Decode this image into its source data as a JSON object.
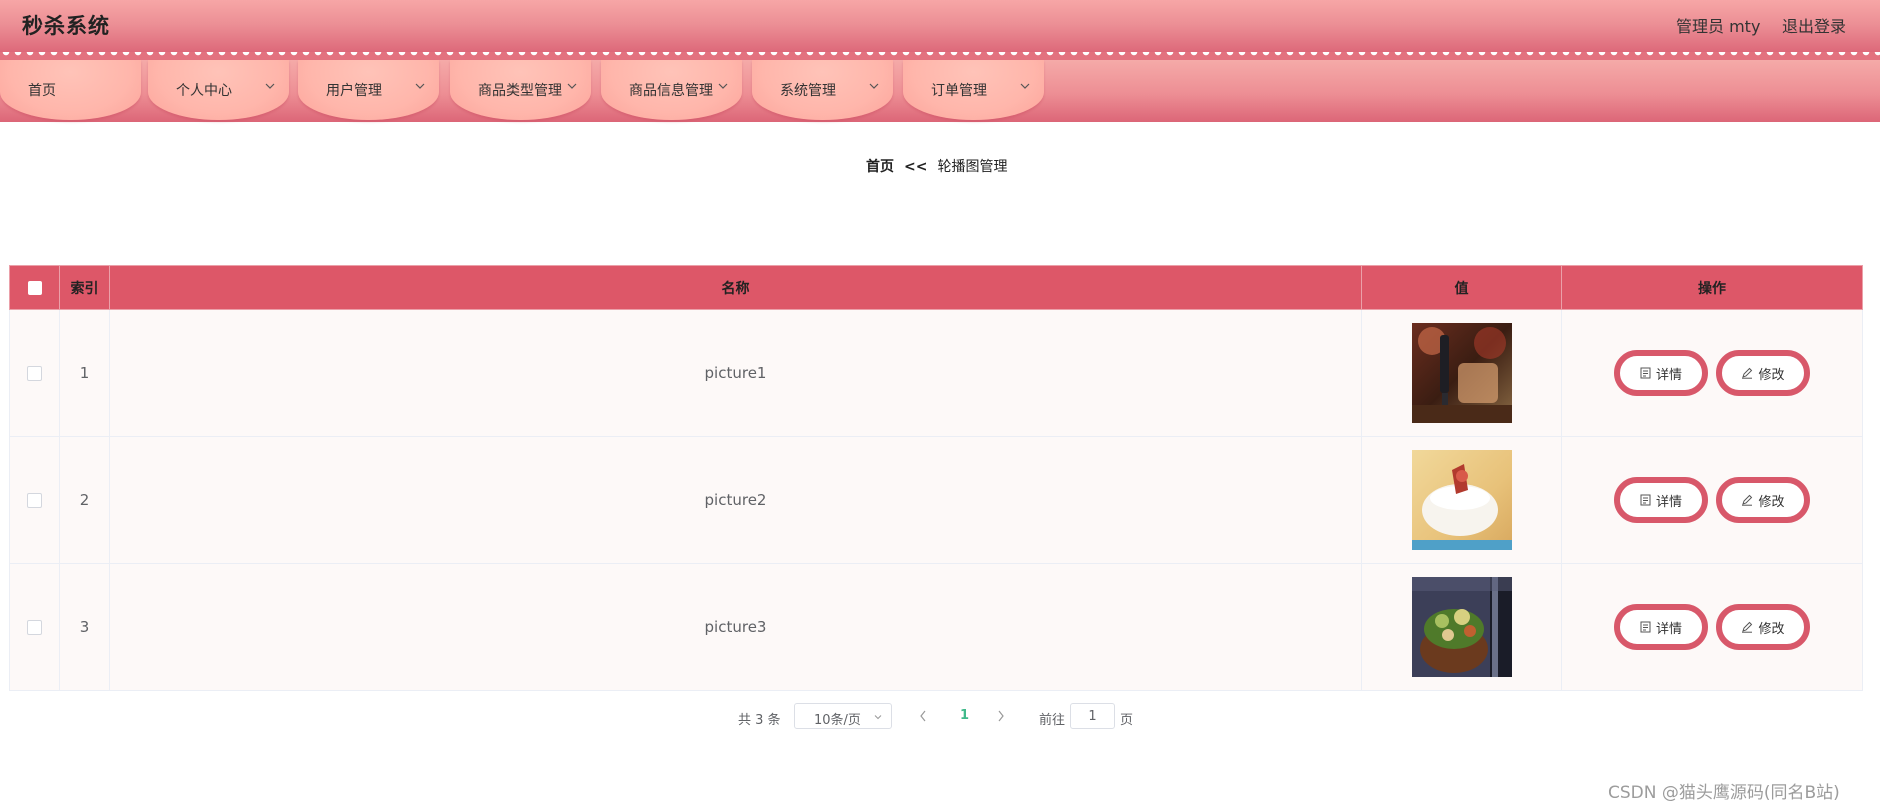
{
  "header": {
    "app_title": "秒杀系统",
    "user_label": "管理员 mty",
    "logout_label": "退出登录"
  },
  "nav": {
    "items": [
      {
        "label": "首页",
        "has_dropdown": false
      },
      {
        "label": "个人中心",
        "has_dropdown": true
      },
      {
        "label": "用户管理",
        "has_dropdown": true
      },
      {
        "label": "商品类型管理",
        "has_dropdown": true
      },
      {
        "label": "商品信息管理",
        "has_dropdown": true
      },
      {
        "label": "系统管理",
        "has_dropdown": true
      },
      {
        "label": "订单管理",
        "has_dropdown": true
      }
    ]
  },
  "breadcrumb": {
    "home": "首页",
    "separator": "<<",
    "current": "轮播图管理"
  },
  "table": {
    "columns": [
      "索引",
      "名称",
      "值",
      "操作"
    ],
    "rows": [
      {
        "index": "1",
        "name": "picture1",
        "image": "photo-dark-cafe"
      },
      {
        "index": "2",
        "name": "picture2",
        "image": "photo-white-dessert"
      },
      {
        "index": "3",
        "name": "picture3",
        "image": "photo-food-bowl"
      }
    ],
    "actions": {
      "detail_label": "详情",
      "edit_label": "修改"
    }
  },
  "pagination": {
    "total_text": "共 3 条",
    "page_size": "10条/页",
    "current_page": "1",
    "goto_label": "前往",
    "goto_value": "1",
    "page_suffix": "页"
  },
  "watermark": "CSDN @猫头鹰源码(同名B站)",
  "colors": {
    "header_accent": "#dc6678",
    "nav_tab": "#ffb6ab",
    "table_header": "#dd5768",
    "button_border": "#d8586a",
    "active_page": "#3fb98a"
  }
}
